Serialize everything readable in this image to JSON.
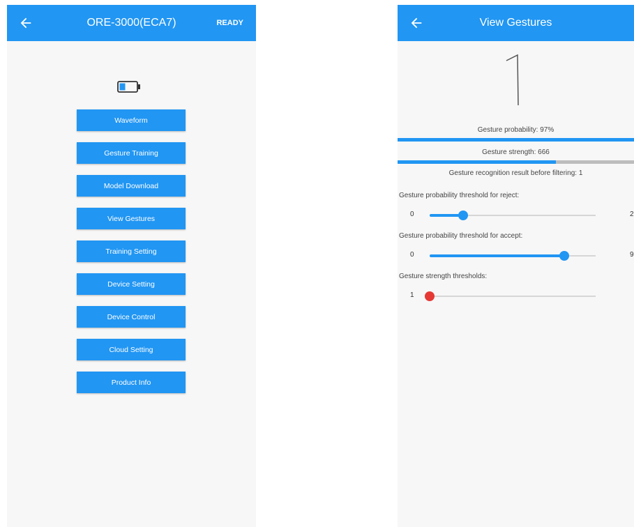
{
  "colors": {
    "accent": "#2196f3",
    "danger": "#e53935"
  },
  "left_screen": {
    "appbar": {
      "back_icon": "arrow-left-icon",
      "title": "ORE-3000(ECA7)",
      "action": "READY"
    },
    "battery_icon": "battery-low-icon",
    "menu": [
      "Waveform",
      "Gesture Training",
      "Model Download",
      "View Gestures",
      "Training Setting",
      "Device Setting",
      "Device Control",
      "Cloud Setting",
      "Product Info"
    ]
  },
  "right_screen": {
    "appbar": {
      "back_icon": "arrow-left-icon",
      "title": "View Gestures"
    },
    "gesture_glyph": "1",
    "probability_text": "Gesture probability:  97%",
    "probability_level": 1.0,
    "strength_text": "Gesture strength:  666",
    "strength_level": 0.67,
    "recognition_text": "Gesture recognition result before filtering: 1",
    "sliders": [
      {
        "label": "Gesture probability threshold for reject:",
        "min": "0",
        "max": "2",
        "value": 0.2,
        "color": "#2196f3"
      },
      {
        "label": "Gesture probability threshold for accept:",
        "min": "0",
        "max": "9",
        "value": 0.81,
        "color": "#2196f3"
      },
      {
        "label": "Gesture strength thresholds:",
        "min": "1",
        "max": "",
        "value": 0.0,
        "color": "#e53935"
      }
    ]
  }
}
